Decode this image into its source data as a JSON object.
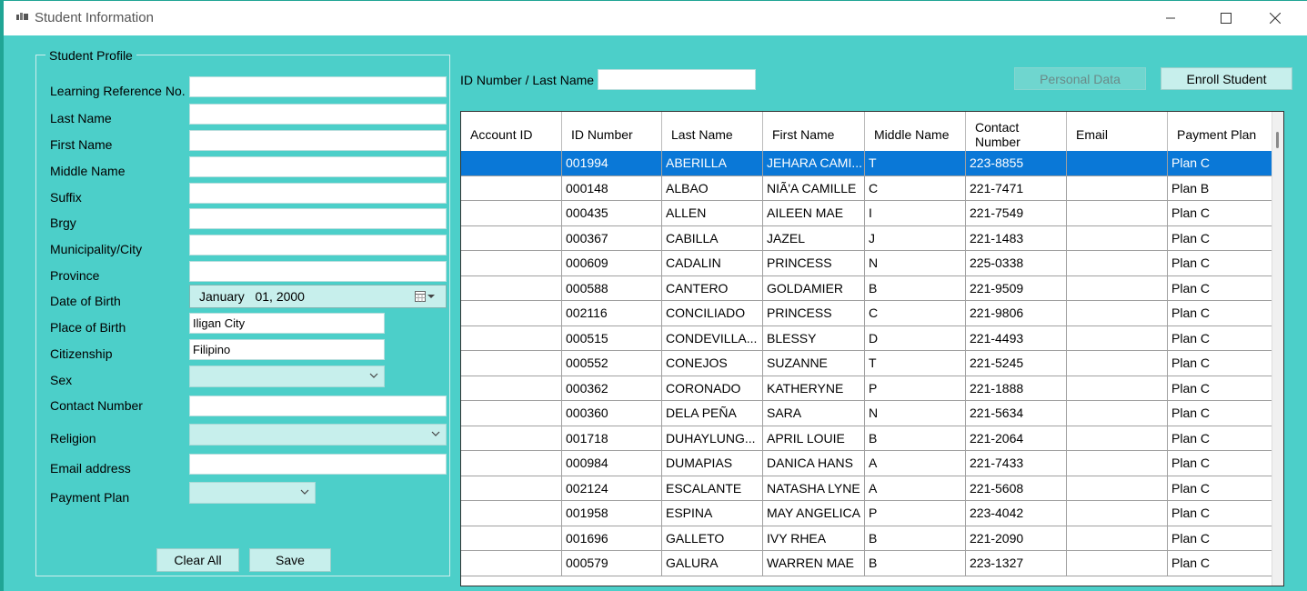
{
  "window": {
    "title": "Student Information"
  },
  "profile": {
    "legend": "Student Profile",
    "fields": {
      "lrn": {
        "label": "Learning Reference No.",
        "value": ""
      },
      "last_name": {
        "label": "Last Name",
        "value": ""
      },
      "first_name": {
        "label": "First Name",
        "value": ""
      },
      "middle_name": {
        "label": "Middle Name",
        "value": ""
      },
      "suffix": {
        "label": "Suffix",
        "value": ""
      },
      "brgy": {
        "label": "Brgy",
        "value": ""
      },
      "municipality": {
        "label": "Municipality/City",
        "value": ""
      },
      "province": {
        "label": "Province",
        "value": ""
      },
      "dob": {
        "label": "Date of Birth",
        "value": "January   01, 2000"
      },
      "place_of_birth": {
        "label": "Place of Birth",
        "value": "Iligan City"
      },
      "citizenship": {
        "label": "Citizenship",
        "value": "Filipino"
      },
      "sex": {
        "label": "Sex",
        "value": ""
      },
      "contact": {
        "label": "Contact Number",
        "value": ""
      },
      "religion": {
        "label": "Religion",
        "value": ""
      },
      "email": {
        "label": "Email address",
        "value": ""
      },
      "payment_plan": {
        "label": "Payment Plan",
        "value": ""
      }
    },
    "buttons": {
      "clear_all": "Clear All",
      "save": "Save"
    }
  },
  "search": {
    "label": "ID Number / Last Name",
    "value": ""
  },
  "actions": {
    "personal_data": "Personal Data",
    "enroll_student": "Enroll Student"
  },
  "table": {
    "columns": [
      "Account ID",
      "ID Number",
      "Last Name",
      "First Name",
      "Middle Name",
      "Contact Number",
      "Email",
      "Payment Plan"
    ],
    "rows": [
      [
        "",
        "001994",
        "ABERILLA",
        "JEHARA CAMI...",
        "T",
        "223-8855",
        "",
        "Plan C"
      ],
      [
        "",
        "000148",
        "ALBAO",
        "NIÃ'A CAMILLE",
        "C",
        "221-7471",
        "",
        "Plan B"
      ],
      [
        "",
        "000435",
        "ALLEN",
        "AILEEN MAE",
        "I",
        "221-7549",
        "",
        "Plan C"
      ],
      [
        "",
        "000367",
        "CABILLA",
        "JAZEL",
        "J",
        "221-1483",
        "",
        "Plan C"
      ],
      [
        "",
        "000609",
        "CADALIN",
        "PRINCESS",
        "N",
        "225-0338",
        "",
        "Plan C"
      ],
      [
        "",
        "000588",
        "CANTERO",
        "GOLDAMIER",
        "B",
        "221-9509",
        "",
        "Plan C"
      ],
      [
        "",
        "002116",
        "CONCILIADO",
        "PRINCESS",
        "C",
        "221-9806",
        "",
        "Plan C"
      ],
      [
        "",
        "000515",
        "CONDEVILLA...",
        "BLESSY",
        "D",
        "221-4493",
        "",
        "Plan C"
      ],
      [
        "",
        "000552",
        "CONEJOS",
        "SUZANNE",
        "T",
        "221-5245",
        "",
        "Plan C"
      ],
      [
        "",
        "000362",
        "CORONADO",
        "KATHERYNE",
        "P",
        "221-1888",
        "",
        "Plan C"
      ],
      [
        "",
        "000360",
        "DELA PEÑA",
        "SARA",
        "N",
        "221-5634",
        "",
        "Plan C"
      ],
      [
        "",
        "001718",
        "DUHAYLUNG...",
        "APRIL LOUIE",
        "B",
        "221-2064",
        "",
        "Plan C"
      ],
      [
        "",
        "000984",
        "DUMAPIAS",
        "DANICA HANS",
        "A",
        "221-7433",
        "",
        "Plan C"
      ],
      [
        "",
        "002124",
        "ESCALANTE",
        "NATASHA LYNE",
        "A",
        "221-5608",
        "",
        "Plan C"
      ],
      [
        "",
        "001958",
        "ESPINA",
        "MAY ANGELICA",
        "P",
        "223-4042",
        "",
        "Plan C"
      ],
      [
        "",
        "001696",
        "GALLETO",
        "IVY RHEA",
        "B",
        "221-2090",
        "",
        "Plan C"
      ],
      [
        "",
        "000579",
        "GALURA",
        "WARREN MAE",
        "B",
        "223-1327",
        "",
        "Plan C"
      ]
    ]
  }
}
